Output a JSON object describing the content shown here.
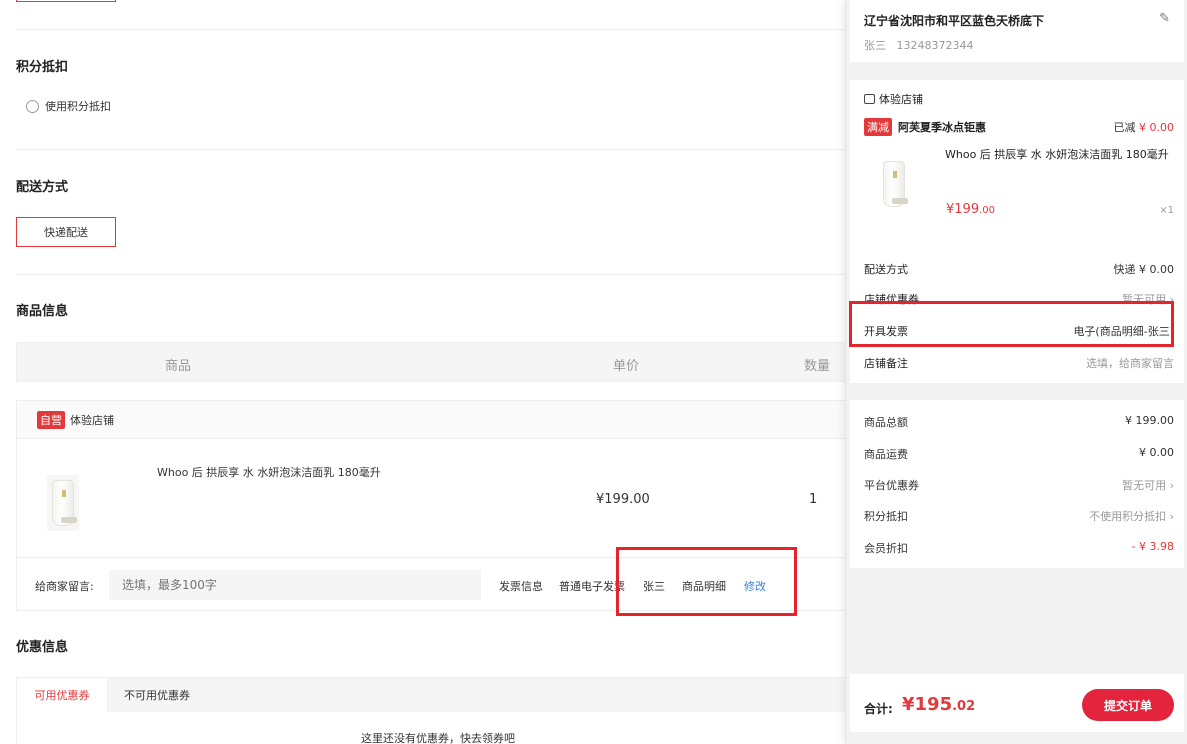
{
  "points": {
    "title": "积分抵扣",
    "option": "使用积分抵扣"
  },
  "shipping": {
    "title": "配送方式",
    "button": "快递配送"
  },
  "goods": {
    "title": "商品信息",
    "headers": [
      "商品",
      "单价",
      "数量"
    ],
    "store_tag": "自营",
    "store_name": "体验店铺",
    "product_name": "Whoo 后 拱辰享 水 水妍泡沫洁面乳 180毫升",
    "unit_price": "¥199.00",
    "quantity": "1",
    "message_label": "给商家留言:",
    "message_placeholder": "选填，最多100字",
    "invoice_label": "发票信息",
    "invoice_type": "普通电子发票",
    "invoice_name": "张三",
    "invoice_content": "商品明细",
    "invoice_edit": "修改"
  },
  "coupons": {
    "title": "优惠信息",
    "tab_available": "可用优惠券",
    "tab_unavailable": "不可用优惠券",
    "empty_text": "这里还没有优惠券，快去领券吧"
  },
  "panel": {
    "address": "辽宁省沈阳市和平区蓝色天桥底下",
    "receiver": "张三",
    "phone": "13248372344",
    "shop_name": "体验店铺",
    "promo_tag": "满减",
    "promo_name": "阿芙夏季冰点钜惠",
    "promo_saved_label": "已减",
    "promo_saved_value": "¥ 0.00",
    "product_name": "Whoo 后 拱辰享 水 水妍泡沫洁面乳 180毫升",
    "product_price_main": "¥199",
    "product_price_decimal": ".00",
    "product_qty": "×1",
    "rows": {
      "delivery_label": "配送方式",
      "delivery_value": "快递 ¥ 0.00",
      "store_coupon_label": "店铺优惠券",
      "store_coupon_value": "暂无可用 ›",
      "invoice_label": "开具发票",
      "invoice_value": "电子(商品明细-张三)",
      "remark_label": "店铺备注",
      "remark_value": "选填，给商家留言"
    },
    "summary": {
      "goods_total_label": "商品总额",
      "goods_total_value": "¥ 199.00",
      "freight_label": "商品运费",
      "freight_value": "¥ 0.00",
      "platform_coupon_label": "平台优惠券",
      "platform_coupon_value": "暂无可用 ›",
      "points_label": "积分抵扣",
      "points_value": "不使用积分抵扣 ›",
      "member_discount_label": "会员折扣",
      "member_discount_value": "- ¥ 3.98"
    },
    "total_label": "合计:",
    "total_main": "¥195",
    "total_decimal": ".02",
    "submit_label": "提交订单"
  },
  "colors": {
    "accent": "#e4393c",
    "highlight": "#e4232a",
    "link": "#3a7fd5"
  }
}
